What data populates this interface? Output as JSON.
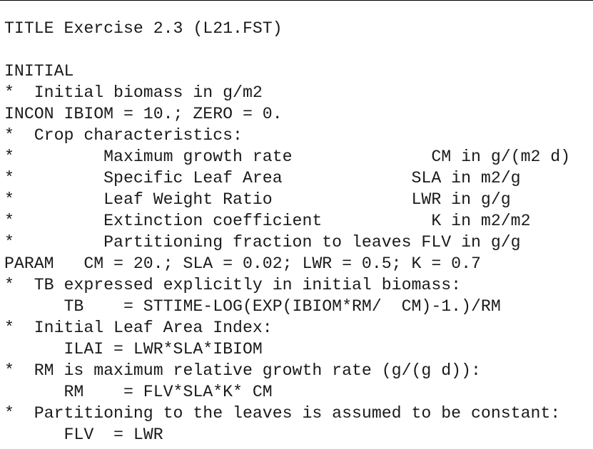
{
  "document": {
    "lines": [
      "TITLE Exercise 2.3 (L21.FST)",
      "",
      "INITIAL",
      "*  Initial biomass in g/m2",
      "INCON IBIOM = 10.; ZERO = 0.",
      "*  Crop characteristics:",
      "*         Maximum growth rate              CM in g/(m2 d)",
      "*         Specific Leaf Area             SLA in m2/g",
      "*         Leaf Weight Ratio              LWR in g/g",
      "*         Extinction coefficient           K in m2/m2",
      "*         Partitioning fraction to leaves FLV in g/g",
      "PARAM   CM = 20.; SLA = 0.02; LWR = 0.5; K = 0.7",
      "*  TB expressed explicitly in initial biomass:",
      "      TB    = STTIME-LOG(EXP(IBIOM*RM/  CM)-1.)/RM",
      "*  Initial Leaf Area Index:",
      "      ILAI = LWR*SLA*IBIOM",
      "*  RM is maximum relative growth rate (g/(g d)):",
      "      RM    = FLV*SLA*K* CM",
      "*  Partitioning to the leaves is assumed to be constant:",
      "      FLV  = LWR"
    ]
  }
}
